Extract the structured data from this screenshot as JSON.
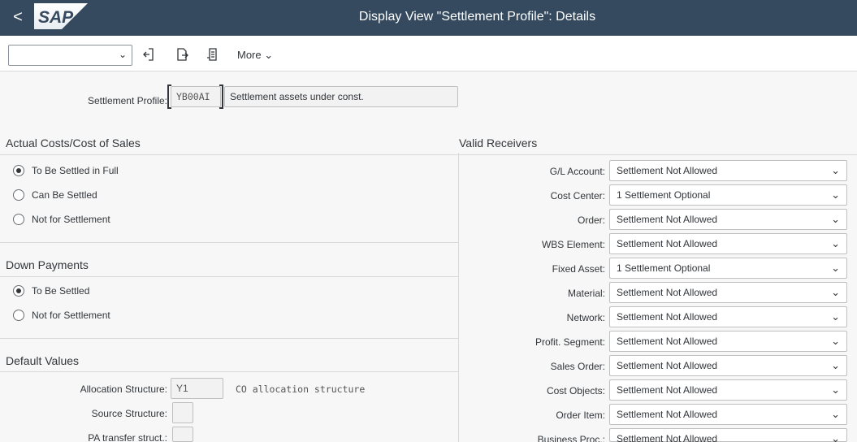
{
  "header": {
    "title": "Display View \"Settlement Profile\": Details",
    "logo_text": "SAP",
    "back_glyph": "<"
  },
  "toolbar": {
    "select_value": "",
    "more_label": "More",
    "icons": [
      "exit-icon",
      "export-icon",
      "print-icon"
    ]
  },
  "settlement_profile": {
    "label": "Settlement Profile:",
    "code": "YB00AI",
    "description": "Settlement assets under const."
  },
  "actual_costs": {
    "title": "Actual Costs/Cost of Sales",
    "options": [
      {
        "label": "To Be Settled in Full",
        "checked": true
      },
      {
        "label": "Can Be Settled",
        "checked": false
      },
      {
        "label": "Not for Settlement",
        "checked": false
      }
    ]
  },
  "down_payments": {
    "title": "Down Payments",
    "options": [
      {
        "label": "To Be Settled",
        "checked": true
      },
      {
        "label": "Not for Settlement",
        "checked": false
      }
    ]
  },
  "default_values": {
    "title": "Default Values",
    "allocation_structure": {
      "label": "Allocation Structure:",
      "value": "Y1",
      "description": "CO allocation structure"
    },
    "source_structure": {
      "label": "Source Structure:",
      "value": ""
    },
    "pa_transfer": {
      "label": "PA transfer struct.:",
      "value": ""
    }
  },
  "valid_receivers": {
    "title": "Valid Receivers",
    "rows": [
      {
        "label": "G/L Account:",
        "value": "Settlement Not Allowed"
      },
      {
        "label": "Cost Center:",
        "value": "1 Settlement Optional"
      },
      {
        "label": "Order:",
        "value": "Settlement Not Allowed"
      },
      {
        "label": "WBS Element:",
        "value": "Settlement Not Allowed"
      },
      {
        "label": "Fixed Asset:",
        "value": "1 Settlement Optional"
      },
      {
        "label": "Material:",
        "value": "Settlement Not Allowed"
      },
      {
        "label": "Network:",
        "value": "Settlement Not Allowed"
      },
      {
        "label": "Profit. Segment:",
        "value": "Settlement Not Allowed"
      },
      {
        "label": "Sales Order:",
        "value": "Settlement Not Allowed"
      },
      {
        "label": "Cost Objects:",
        "value": "Settlement Not Allowed"
      },
      {
        "label": "Order Item:",
        "value": "Settlement Not Allowed"
      },
      {
        "label": "Business Proc.:",
        "value": "Settlement Not Allowed"
      }
    ]
  },
  "colors": {
    "shell": "#354a5f",
    "background": "#f7f7f7",
    "field_readonly": "#f2f2f2"
  }
}
